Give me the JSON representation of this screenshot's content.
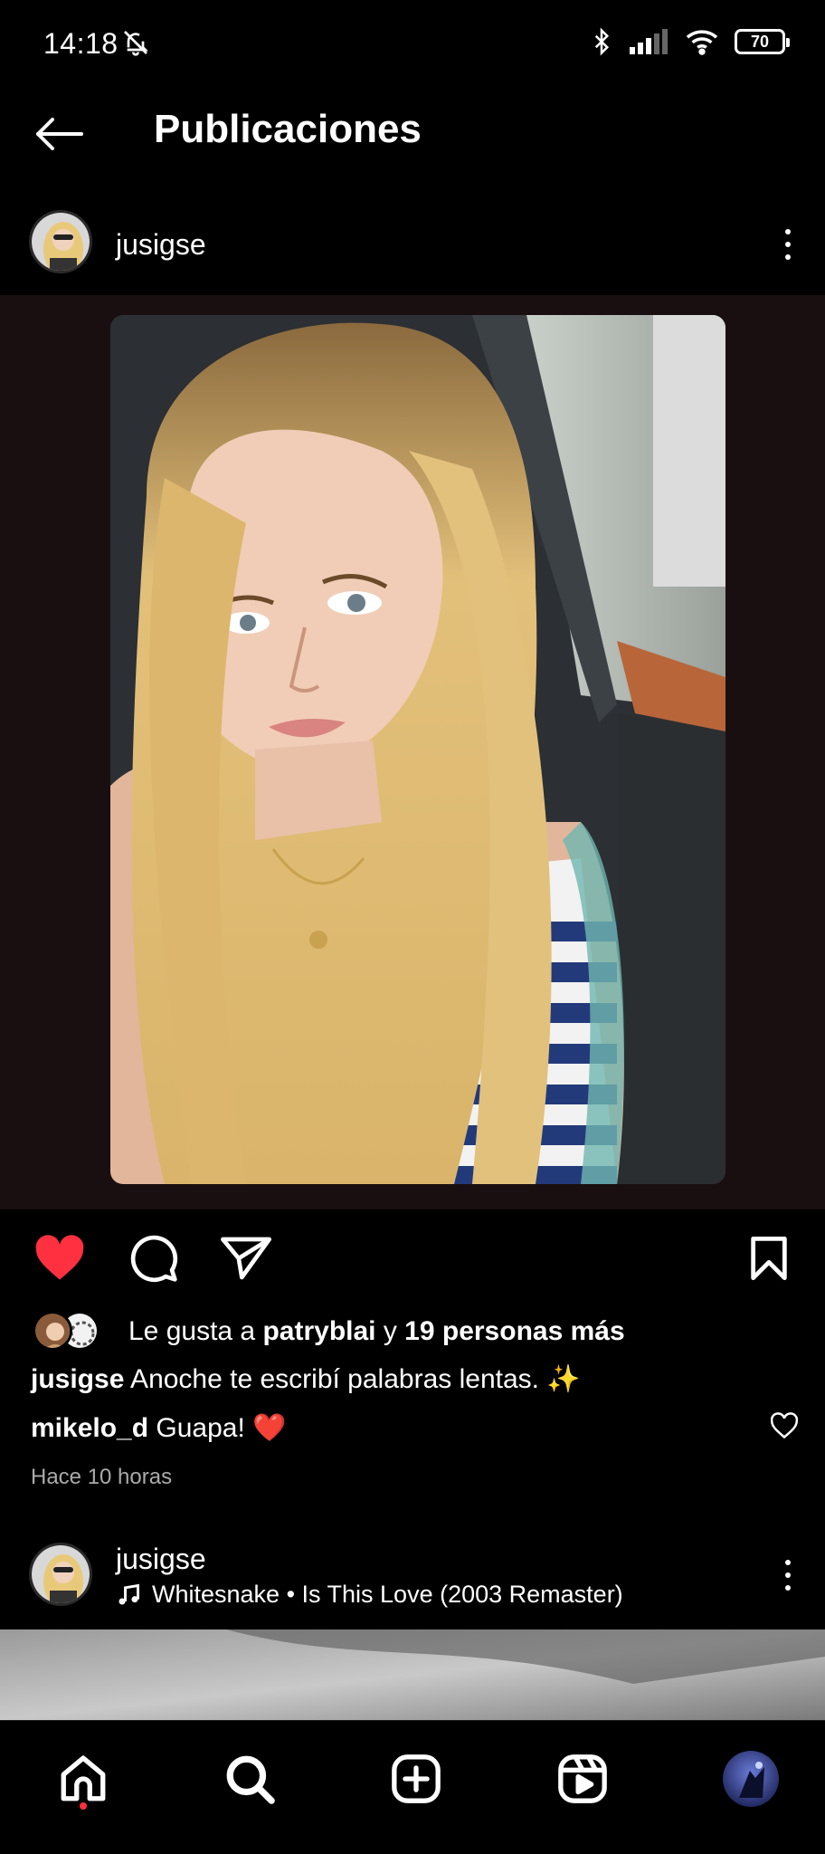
{
  "status_bar": {
    "time": "14:18",
    "battery": "70",
    "icons": [
      "bell-off-icon",
      "bluetooth-icon",
      "signal-icon",
      "wifi-icon",
      "battery-icon"
    ]
  },
  "header": {
    "title": "Publicaciones",
    "back_icon": "arrow-left-icon"
  },
  "post": {
    "username": "jusigse",
    "likes": {
      "prefix": "Le gusta a ",
      "user": "patryblai",
      "middle": " y ",
      "count": "19 personas más"
    },
    "caption": {
      "user": "jusigse",
      "text": " Anoche te escribí palabras lentas. ✨"
    },
    "comment": {
      "user": "mikelo_d",
      "text": " Guapa! ❤️"
    },
    "time_ago": "Hace 10 horas",
    "liked": true,
    "colors": {
      "like_red": "#ff3040"
    }
  },
  "next_post": {
    "username": "jusigse",
    "music": "Whitesnake • Is This Love (2003 Remaster)"
  },
  "bottom_nav": {
    "items": [
      "home-icon",
      "search-icon",
      "create-icon",
      "reels-icon",
      "profile-avatar"
    ]
  }
}
